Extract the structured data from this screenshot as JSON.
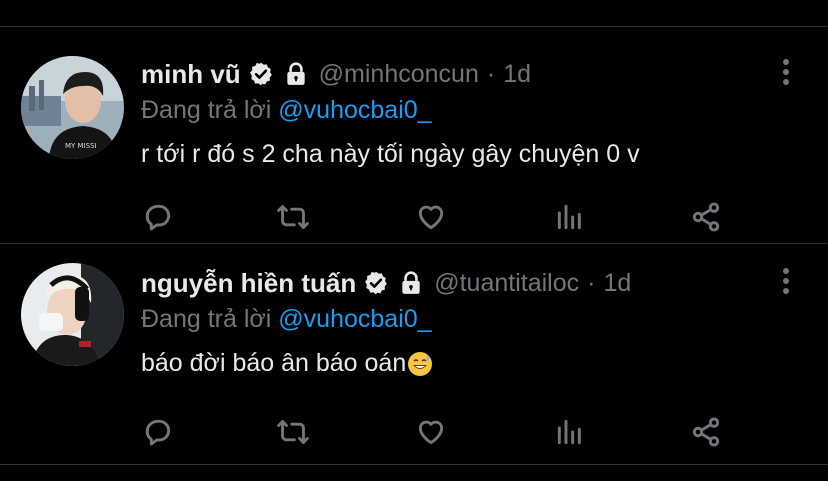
{
  "tweets": [
    {
      "name": "minh vũ",
      "handle": "@minhconcun",
      "separator": "·",
      "time": "1d",
      "replying_prefix": "Đang trả lời",
      "replying_to": "@vuhocbai0_",
      "text": "r tới r đó s 2 cha này tối ngày gây chuyện 0 v",
      "avatar_icon": "profile-photo",
      "verified_icon": "verified-badge-icon",
      "lock_icon": "lock-icon"
    },
    {
      "name": "nguyễn hiền tuấn",
      "handle": "@tuantitailoc",
      "separator": "·",
      "time": "1d",
      "replying_prefix": "Đang trả lời",
      "replying_to": "@vuhocbai0_",
      "text": "báo đời báo ân báo oán",
      "emoji": "grinning-sweat-emoji",
      "avatar_icon": "profile-photo",
      "verified_icon": "verified-badge-icon",
      "lock_icon": "lock-icon"
    }
  ],
  "actions": [
    "reply-icon",
    "retweet-icon",
    "like-icon",
    "analytics-icon",
    "share-icon"
  ],
  "colors": {
    "background": "#000000",
    "text_primary": "#e7e9ea",
    "text_secondary": "#71767b",
    "accent": "#1d9bf0",
    "divider": "#2f3336"
  }
}
